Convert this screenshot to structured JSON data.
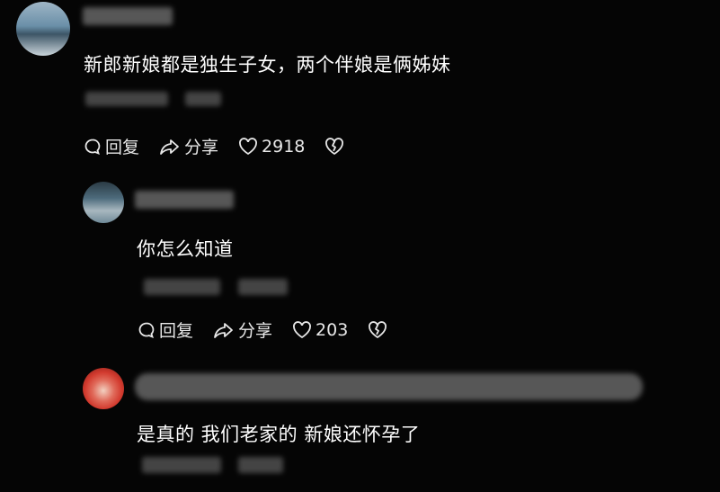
{
  "comments": [
    {
      "text": "新郎新娘都是独生子女，两个伴娘是俩姊妹",
      "reply_label": "回复",
      "share_label": "分享",
      "likes": "2918",
      "avatar_colors": [
        "#6a8fa8",
        "#3d5566",
        "#c9d4da"
      ]
    },
    {
      "text": "你怎么知道",
      "reply_label": "回复",
      "share_label": "分享",
      "likes": "203",
      "avatar_colors": [
        "#4d6b7c",
        "#2b3b45",
        "#a8b7bf"
      ]
    },
    {
      "text": "是真的 我们老家的 新娘还怀孕了",
      "avatar_colors": [
        "#d23a2e",
        "#f2d0c0",
        "#7a1a14"
      ]
    }
  ],
  "icons": {
    "reply": "comment-bubble-icon",
    "share": "share-arrow-icon",
    "like": "heart-icon",
    "dislike": "broken-heart-icon"
  }
}
